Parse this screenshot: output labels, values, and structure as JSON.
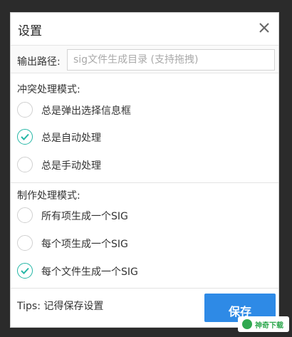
{
  "dialog": {
    "title": "设置",
    "close_icon": "close-icon"
  },
  "output_path": {
    "label": "输出路径:",
    "placeholder": "sig文件生成目录 (支持拖拽)",
    "value": ""
  },
  "conflict_mode": {
    "label": "冲突处理模式:",
    "options": [
      {
        "label": "总是弹出选择信息框",
        "checked": false
      },
      {
        "label": "总是自动处理",
        "checked": true
      },
      {
        "label": "总是手动处理",
        "checked": false
      }
    ]
  },
  "make_mode": {
    "label": "制作处理模式:",
    "options": [
      {
        "label": "所有项生成一个SIG",
        "checked": false
      },
      {
        "label": "每个项生成一个SIG",
        "checked": false
      },
      {
        "label": "每个文件生成一个SIG",
        "checked": true
      }
    ]
  },
  "footer": {
    "tips": "Tips: 记得保存设置",
    "save_label": "保存"
  },
  "watermark": {
    "text": "神奇下载"
  },
  "colors": {
    "accent": "#25b7a6",
    "button": "#2e8ae6"
  }
}
